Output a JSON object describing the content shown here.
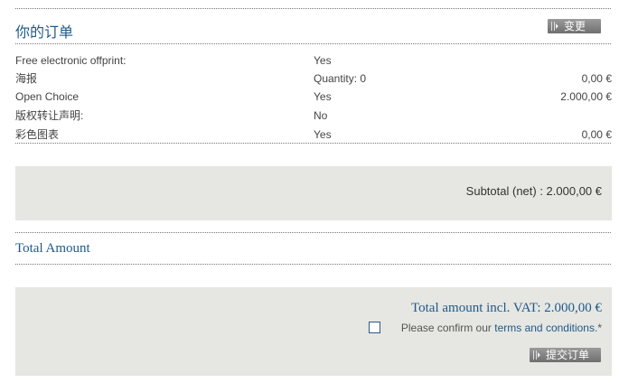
{
  "order": {
    "title": "你的订单",
    "change_button": "变更",
    "rows": [
      {
        "label": "Free electronic offprint:",
        "value": "Yes",
        "price": ""
      },
      {
        "label": "海报",
        "value": "Quantity: 0",
        "price": "0,00 €"
      },
      {
        "label": "Open Choice",
        "value": "Yes",
        "price": "2.000,00 €"
      },
      {
        "label": "版权转让声明:",
        "value": "No",
        "price": ""
      },
      {
        "label": "彩色图表",
        "value": "Yes",
        "price": "0,00 €"
      }
    ],
    "subtotal": "Subtotal (net) : 2.000,00 €"
  },
  "total": {
    "title": "Total Amount",
    "amount_incl_vat": "Total amount incl. VAT: 2.000,00 €",
    "confirm_prefix": "Please confirm our ",
    "terms_link": "terms and conditions",
    "confirm_suffix": ".*",
    "submit_button": "提交订单"
  },
  "icons": [
    "button-arrow-icon",
    "checkbox-icon"
  ],
  "colors": {
    "heading": "#1f5a8a",
    "panel": "#e6e6e2",
    "button": "#7a7a7a"
  }
}
